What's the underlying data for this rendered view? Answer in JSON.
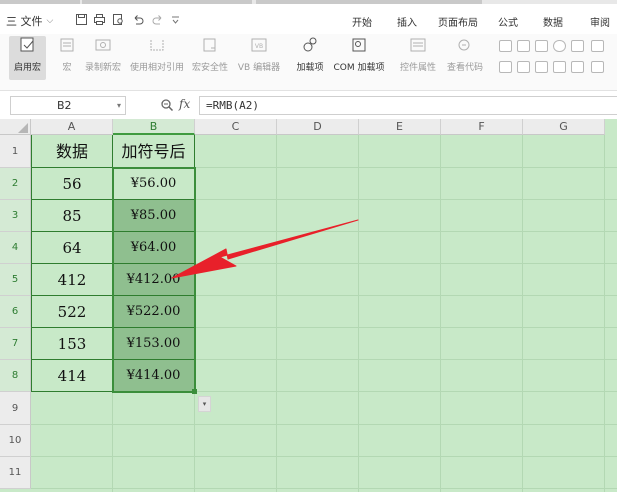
{
  "menu": {
    "file_label": "三 文件",
    "file_chevron": "⌵",
    "tabs": [
      "开始",
      "插入",
      "页面布局",
      "公式",
      "数据",
      "审阅"
    ]
  },
  "ribbon": {
    "buttons": [
      "启用宏",
      "宏",
      "录制新宏",
      "使用相对引用",
      "宏安全性",
      "VB 编辑器",
      "加载项",
      "COM 加载项",
      "控件属性",
      "查看代码"
    ]
  },
  "formula_bar": {
    "cell_ref": "B2",
    "fx_label": "fx",
    "formula": "=RMB(A2)"
  },
  "sheet": {
    "columns": [
      "A",
      "B",
      "C",
      "D",
      "E",
      "F",
      "G"
    ],
    "rows": [
      "1",
      "2",
      "3",
      "4",
      "5",
      "6",
      "7",
      "8",
      "9",
      "10",
      "11"
    ],
    "header_A": "数据",
    "header_B": "加符号后",
    "data_A": [
      "56",
      "85",
      "64",
      "412",
      "522",
      "153",
      "414"
    ],
    "data_B": [
      "¥56.00",
      "¥85.00",
      "¥64.00",
      "¥412.00",
      "¥522.00",
      "¥153.00",
      "¥414.00"
    ]
  },
  "colors": {
    "grid_bg": "#c8e9c8",
    "selection_border": "#3b8e3b",
    "selected_fill": "#8fbf8f",
    "arrow": "#e8202a"
  },
  "icons": [
    "menu-icon",
    "save-icon",
    "print-icon",
    "print-preview-icon",
    "undo-icon",
    "redo-icon",
    "customize-icon",
    "zoom-icon",
    "autofill-options-icon",
    "red-arrow"
  ]
}
